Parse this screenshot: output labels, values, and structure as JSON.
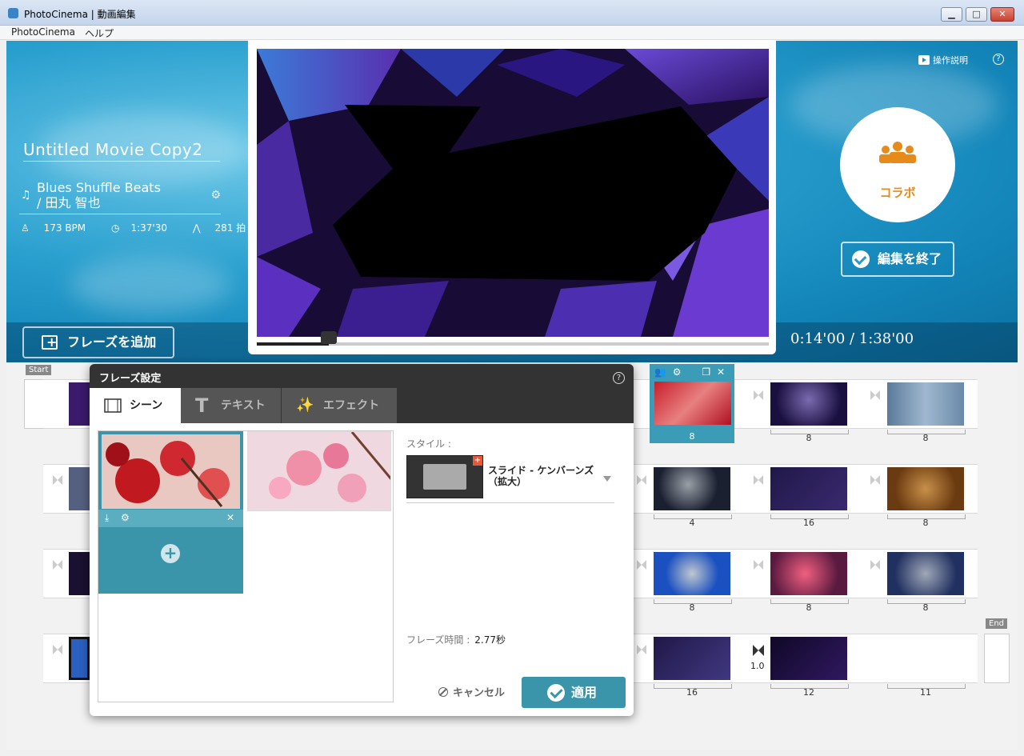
{
  "window": {
    "title": "PhotoCinema | 動画編集",
    "minimize": "▁",
    "maximize": "□",
    "close": "✕"
  },
  "menu": {
    "items": [
      "PhotoCinema",
      "ヘルプ"
    ]
  },
  "movie": {
    "title": "Untitled Movie Copy2",
    "song_line1": "Blues Shuffle Beats",
    "song_line2": " / 田丸 智也",
    "bpm": "173 BPM",
    "duration": "1:37'30",
    "beats": "281 拍"
  },
  "header": {
    "help_label": "操作説明",
    "help_q": "?",
    "collab_label": "コラボ",
    "finish_label": "編集を終了",
    "add_phrase_label": "フレーズを追加",
    "timecode": "0:14'00 / 1:38'00"
  },
  "player": {
    "progress": 0.14
  },
  "timeline": {
    "start_label": "Start",
    "end_label": "End",
    "transition_value": "1.0",
    "rows": [
      [
        "8",
        "8",
        "8"
      ],
      [
        "4",
        "16",
        "8"
      ],
      [
        "8",
        "8",
        "8"
      ],
      [
        "16",
        "12",
        "11"
      ]
    ]
  },
  "dialog": {
    "title": "フレーズ設定",
    "help_q": "?",
    "tabs": [
      "シーン",
      "テキスト",
      "エフェクト"
    ],
    "style_label": "スタイル :",
    "style_name": "スライド - ケンバーンズ（拡大）",
    "duration_label": "フレーズ時間 :",
    "duration_value": "2.77秒",
    "cancel_label": "キャンセル",
    "apply_label": "適用"
  },
  "colors": {
    "accent": "#3a94aa",
    "collab": "#e68a1a",
    "banner": "#1a8fc3"
  }
}
